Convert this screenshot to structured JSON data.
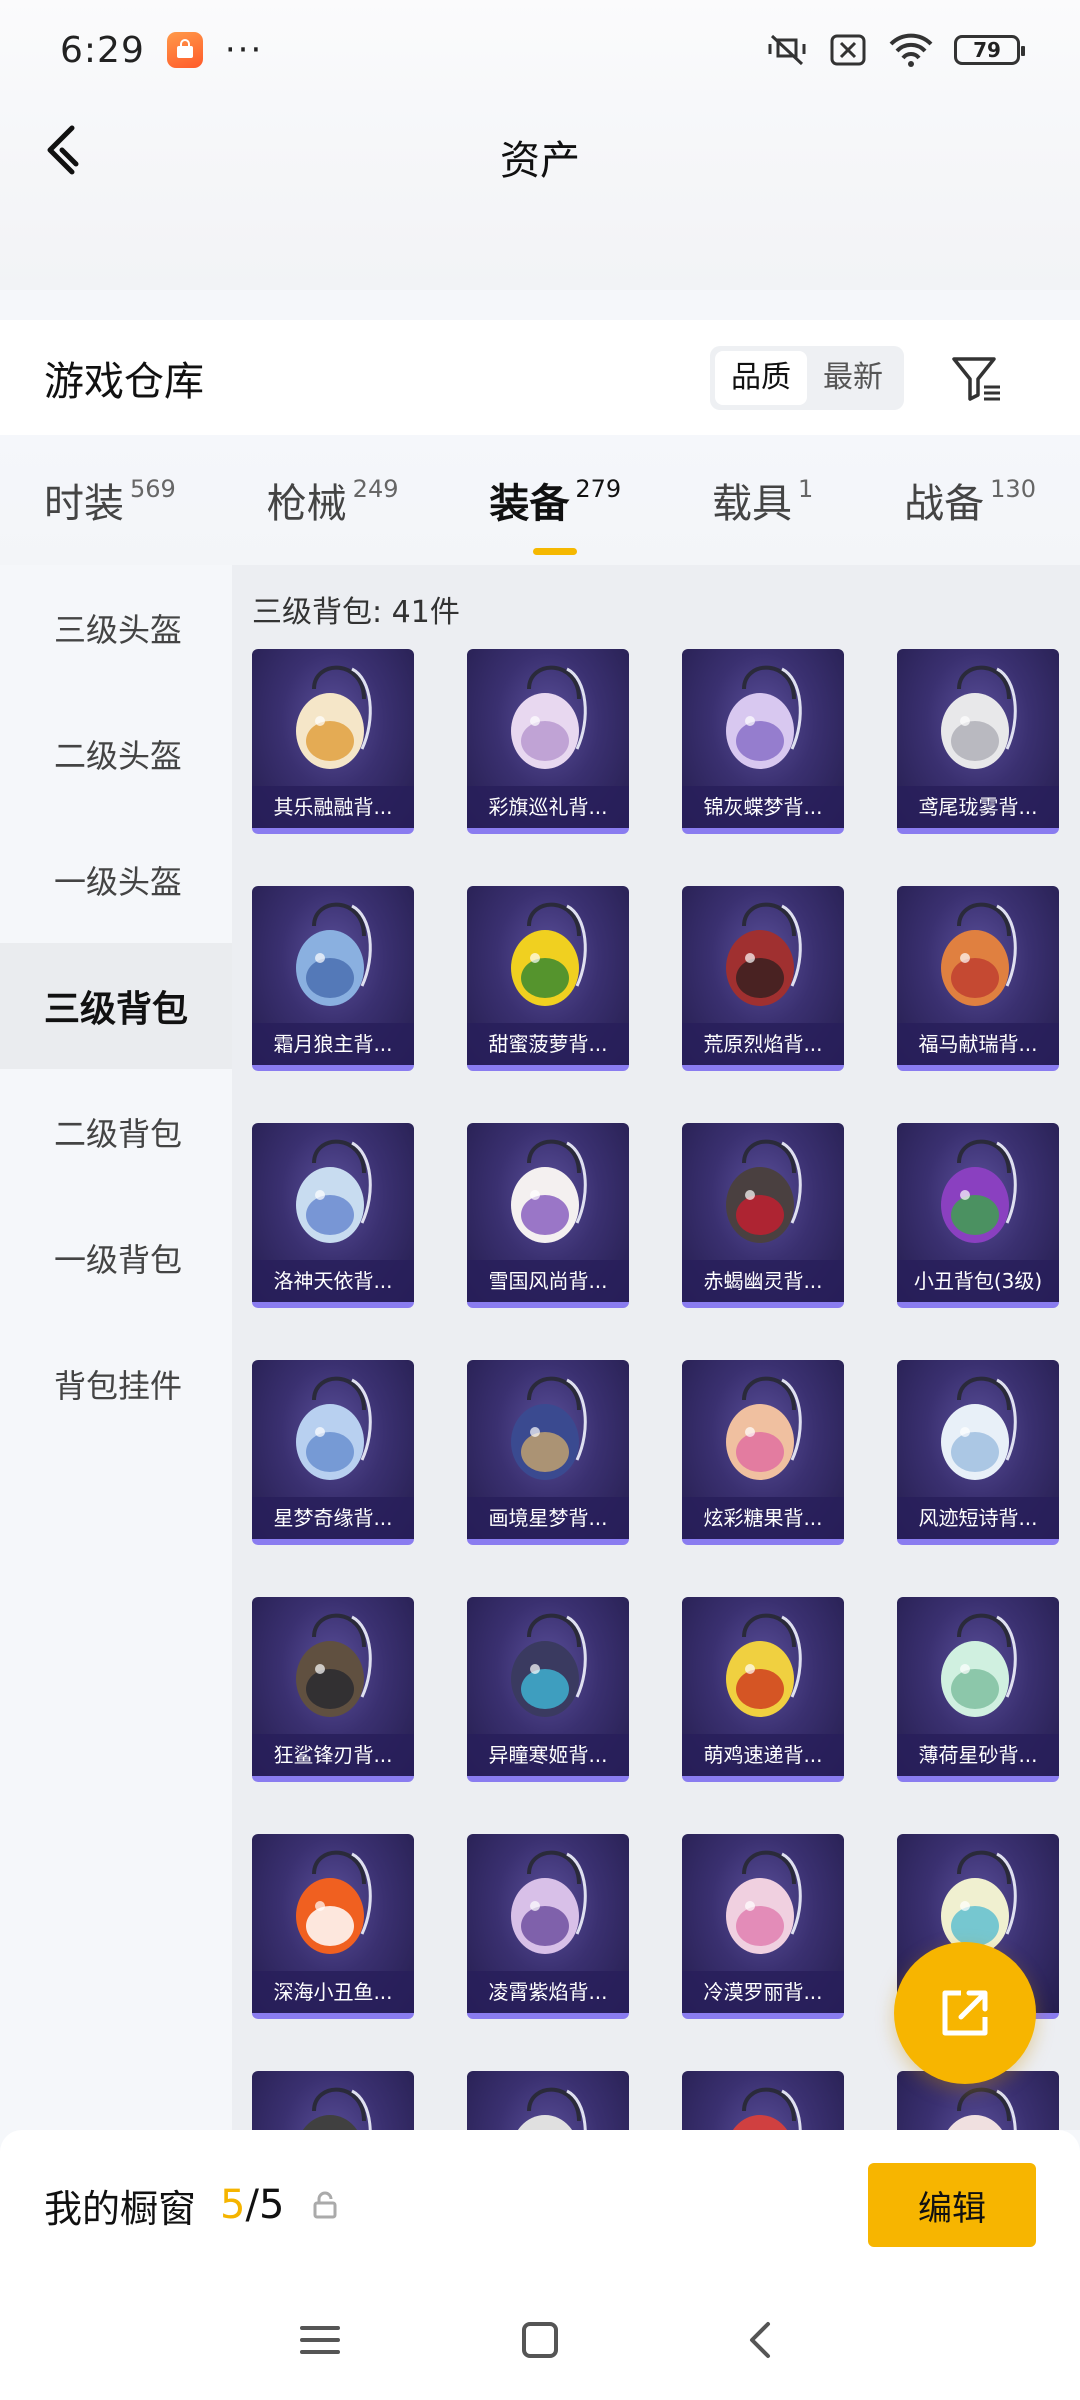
{
  "status_bar": {
    "time": "6:29",
    "dots": "···",
    "battery": "79"
  },
  "header": {
    "title": "资产"
  },
  "warehouse": {
    "title": "游戏仓库",
    "sort_options": [
      "品质",
      "最新"
    ],
    "active_sort": "品质"
  },
  "tabs": [
    {
      "label": "时装",
      "count": "569"
    },
    {
      "label": "枪械",
      "count": "249"
    },
    {
      "label": "装备",
      "count": "279",
      "active": true
    },
    {
      "label": "载具",
      "count": "1"
    },
    {
      "label": "战备",
      "count": "130"
    }
  ],
  "sidebar": {
    "items": [
      "三级头盔",
      "二级头盔",
      "一级头盔",
      "三级背包",
      "二级背包",
      "一级背包",
      "背包挂件"
    ],
    "active": "三级背包"
  },
  "content": {
    "heading": "三级背包: 41件",
    "items": [
      "其乐融融背...",
      "彩旗巡礼背...",
      "锦灰蝶梦背...",
      "鸢尾珑雾背...",
      "霜月狼主背...",
      "甜蜜菠萝背...",
      "荒原烈焰背...",
      "福马献瑞背...",
      "洛神天依背...",
      "雪国风尚背...",
      "赤蝎幽灵背...",
      "小丑背包(3级)",
      "星梦奇缘背...",
      "画境星梦背...",
      "炫彩糖果背...",
      "风迹短诗背...",
      "狂鲨锋刃背...",
      "异瞳寒姬背...",
      "萌鸡速递背...",
      "薄荷星砂背...",
      "深海小丑鱼...",
      "凌霄紫焰背...",
      "冷漠罗丽背...",
      "",
      "",
      "",
      "",
      ""
    ]
  },
  "colors": {
    "accent": "#f7b500",
    "card_bg": "#3a3070",
    "card_border": "#8a7cf0"
  },
  "bottom_bar": {
    "label": "我的橱窗",
    "used": "5",
    "total": "/5",
    "edit_label": "编辑"
  },
  "icons": {
    "back": "chevron-left-icon",
    "filter": "funnel-filter-icon",
    "share": "share-out-icon",
    "lock": "lock-icon",
    "nav_menu": "menu-icon",
    "nav_home": "square-home-icon",
    "nav_back": "chevron-left-icon"
  }
}
